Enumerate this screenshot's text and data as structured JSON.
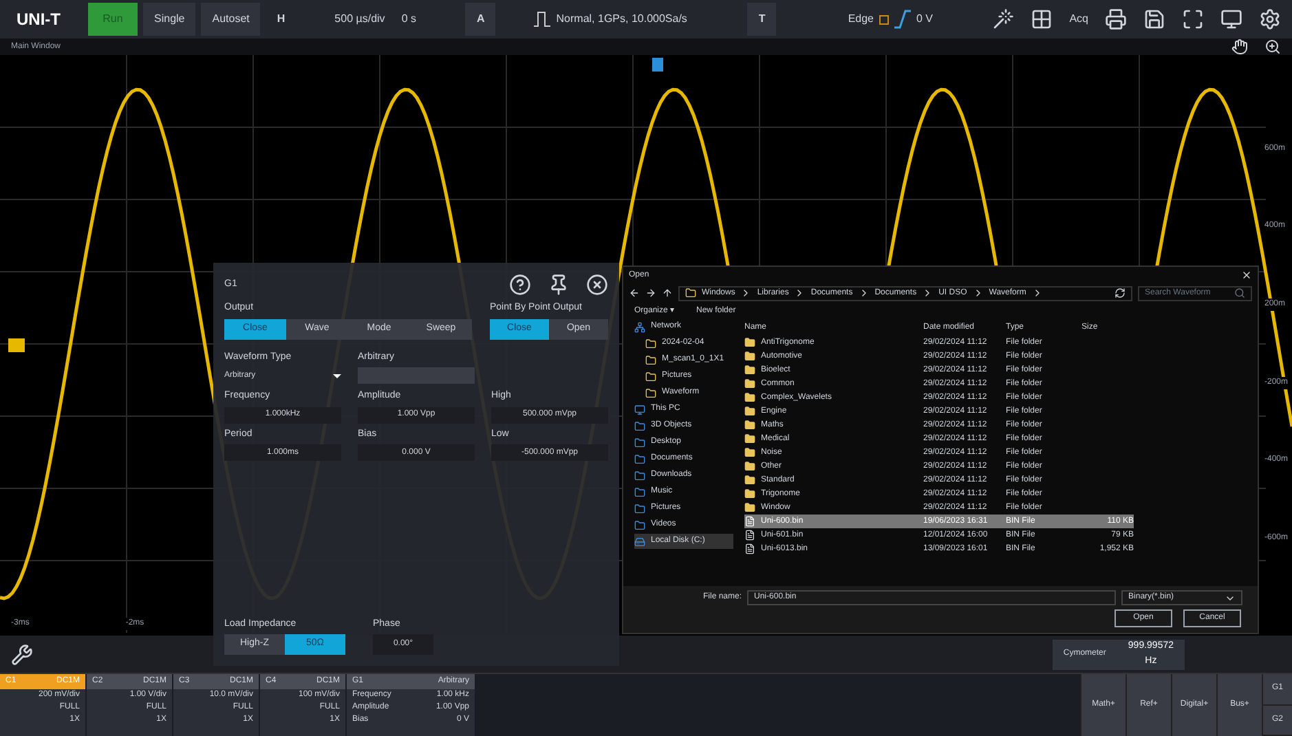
{
  "toolbar": {
    "logo": "UNI-T",
    "run_button": {
      "label": "Run",
      "running": true
    },
    "buttons": [
      "Single",
      "Autoset"
    ],
    "h_label": "H",
    "timebase": "500 µs/div",
    "offset": "0 s",
    "a_label": "A",
    "acquire": "Normal, 1GPs, 10.000Sa/s",
    "t_label": "T",
    "trigger_type": "Edge",
    "trigger_level": "0 V",
    "acq_label": "Acq"
  },
  "subbar": {
    "title": "Main Window"
  },
  "plot": {
    "y_labels": [
      "600m",
      "400m",
      "200m",
      "-200m",
      "-400m",
      "-600m"
    ],
    "x_labels": [
      "-3ms",
      "-2ms"
    ]
  },
  "generator_dialog": {
    "title": "G1",
    "output_label": "Output",
    "output_options": [
      {
        "label": "Close",
        "selected": true
      },
      {
        "label": "Wave",
        "selected": false
      },
      {
        "label": "Mode",
        "selected": false
      },
      {
        "label": "Sweep",
        "selected": false
      }
    ],
    "pbp_label": "Point By Point Output",
    "pbp_options": [
      {
        "label": "Close",
        "selected": true
      },
      {
        "label": "Open",
        "selected": false
      }
    ],
    "waveform_type_label": "Waveform Type",
    "waveform_type": "Arbitrary",
    "arbitrary_label": "Arbitrary",
    "fields": [
      {
        "label": "Frequency",
        "value": "1.000kHz"
      },
      {
        "label": "Amplitude",
        "value": "1.000 Vpp"
      },
      {
        "label": "High",
        "value": "500.000 mVpp"
      },
      {
        "label": "Period",
        "value": "1.000ms"
      },
      {
        "label": "Bias",
        "value": "0.000 V"
      },
      {
        "label": "Low",
        "value": "-500.000 mVpp"
      }
    ],
    "load_label": "Load Impedance",
    "load_options": [
      {
        "label": "High-Z",
        "selected": false
      },
      {
        "label": "50Ω",
        "selected": true
      }
    ],
    "phase_label": "Phase",
    "phase": "0.00°"
  },
  "file_dialog": {
    "title": "Open",
    "breadcrumb": [
      "Windows",
      "Libraries",
      "Documents",
      "Documents",
      "UI DSO",
      "Waveform"
    ],
    "search_placeholder": "Search Waveform",
    "organize": "Organize ▾",
    "new_folder": "New folder",
    "nav": [
      {
        "label": "Network",
        "kind": "network",
        "selected": false
      },
      {
        "label": "2024-02-04",
        "kind": "folder",
        "selected": false
      },
      {
        "label": "M_scan1_0_1X1",
        "kind": "folder",
        "selected": false
      },
      {
        "label": "Pictures",
        "kind": "folder",
        "selected": false
      },
      {
        "label": "Waveform",
        "kind": "folder",
        "selected": false
      },
      {
        "label": "This PC",
        "kind": "pc",
        "selected": false
      },
      {
        "label": "3D Objects",
        "kind": "system",
        "selected": false
      },
      {
        "label": "Desktop",
        "kind": "system",
        "selected": false
      },
      {
        "label": "Documents",
        "kind": "system",
        "selected": false
      },
      {
        "label": "Downloads",
        "kind": "system",
        "selected": false
      },
      {
        "label": "Music",
        "kind": "system",
        "selected": false
      },
      {
        "label": "Pictures",
        "kind": "system",
        "selected": false
      },
      {
        "label": "Videos",
        "kind": "system",
        "selected": false
      },
      {
        "label": "Local Disk (C:)",
        "kind": "disk",
        "selected": true
      }
    ],
    "columns": [
      "Name",
      "Date modified",
      "Type",
      "Size"
    ],
    "rows": [
      {
        "name": "AntiTrigonome",
        "date": "29/02/2024 11:12",
        "type": "File folder",
        "kind": "folder",
        "selected": false
      },
      {
        "name": "Automotive",
        "date": "29/02/2024 11:12",
        "type": "File folder",
        "kind": "folder",
        "selected": false
      },
      {
        "name": "Bioelect",
        "date": "29/02/2024 11:12",
        "type": "File folder",
        "kind": "folder",
        "selected": false
      },
      {
        "name": "Common",
        "date": "29/02/2024 11:12",
        "type": "File folder",
        "kind": "folder",
        "selected": false
      },
      {
        "name": "Complex_Wavelets",
        "date": "29/02/2024 11:12",
        "type": "File folder",
        "kind": "folder",
        "selected": false
      },
      {
        "name": "Engine",
        "date": "29/02/2024 11:12",
        "type": "File folder",
        "kind": "folder",
        "selected": false
      },
      {
        "name": "Maths",
        "date": "29/02/2024 11:12",
        "type": "File folder",
        "kind": "folder",
        "selected": false
      },
      {
        "name": "Medical",
        "date": "29/02/2024 11:12",
        "type": "File folder",
        "kind": "folder",
        "selected": false
      },
      {
        "name": "Noise",
        "date": "29/02/2024 11:12",
        "type": "File folder",
        "kind": "folder",
        "selected": false
      },
      {
        "name": "Other",
        "date": "29/02/2024 11:12",
        "type": "File folder",
        "kind": "folder",
        "selected": false
      },
      {
        "name": "Standard",
        "date": "29/02/2024 11:12",
        "type": "File folder",
        "kind": "folder",
        "selected": false
      },
      {
        "name": "Trigonome",
        "date": "29/02/2024 11:12",
        "type": "File folder",
        "kind": "folder",
        "selected": false
      },
      {
        "name": "Window",
        "date": "29/02/2024 11:12",
        "type": "File folder",
        "kind": "folder",
        "selected": false
      },
      {
        "name": "Uni-600.bin",
        "date": "19/06/2023 16:31",
        "type": "BIN File",
        "size": "110 KB",
        "kind": "file",
        "selected": true
      },
      {
        "name": "Uni-601.bin",
        "date": "12/01/2024 16:00",
        "type": "BIN File",
        "size": "79 KB",
        "kind": "file",
        "selected": false
      },
      {
        "name": "Uni-6013.bin",
        "date": "13/09/2023 16:01",
        "type": "BIN File",
        "size": "1,952 KB",
        "kind": "file",
        "selected": false
      }
    ],
    "file_name_label": "File name:",
    "file_name": "Uni-600.bin",
    "filter": "Binary(*.bin)",
    "open": "Open",
    "cancel": "Cancel"
  },
  "cymometer": {
    "label": "Cymometer",
    "value": "999.99572",
    "unit": "Hz"
  },
  "channels": [
    {
      "name": "C1",
      "coupling": "DC1M",
      "scale": "200 mV/div",
      "bw": "FULL",
      "probe": "1X",
      "selected": true
    },
    {
      "name": "C2",
      "coupling": "DC1M",
      "scale": "1.00 V/div",
      "bw": "FULL",
      "probe": "1X",
      "selected": false
    },
    {
      "name": "C3",
      "coupling": "DC1M",
      "scale": "10.0 mV/div",
      "bw": "FULL",
      "probe": "1X",
      "selected": false
    },
    {
      "name": "C4",
      "coupling": "DC1M",
      "scale": "100 mV/div",
      "bw": "FULL",
      "probe": "1X",
      "selected": false
    }
  ],
  "generator": {
    "name": "G1",
    "type": "Arbitrary",
    "params": [
      {
        "label": "Frequency",
        "value": "1.00 kHz"
      },
      {
        "label": "Amplitude",
        "value": "1.00 Vpp"
      },
      {
        "label": "Bias",
        "value": "0 V"
      }
    ]
  },
  "menu_buttons": [
    "Math+",
    "Ref+",
    "Digital+",
    "Bus+"
  ],
  "side_buttons": [
    "G1",
    "G2"
  ]
}
